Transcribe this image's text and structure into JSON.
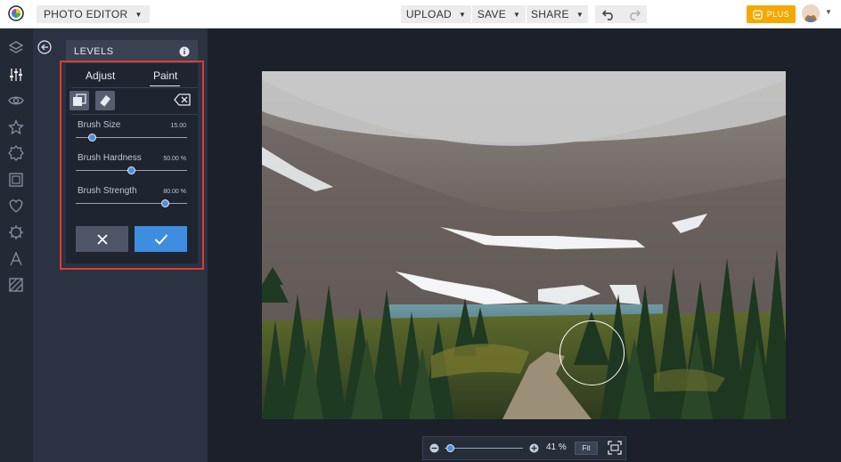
{
  "topbar": {
    "app_label": "PHOTO EDITOR",
    "menus": [
      {
        "label": "UPLOAD"
      },
      {
        "label": "SAVE"
      },
      {
        "label": "SHARE"
      }
    ],
    "plus_label": "PLUS",
    "accent_color": "#f5a800"
  },
  "left_toolbar": {
    "icons": [
      "layers-icon",
      "adjust-sliders-icon",
      "eye-icon",
      "star-icon",
      "badge-icon",
      "frame-icon",
      "heart-icon",
      "gear-icon",
      "text-icon",
      "texture-icon"
    ]
  },
  "panel": {
    "title": "LEVELS",
    "tabs": [
      {
        "label": "Adjust"
      },
      {
        "label": "Paint",
        "active": true
      }
    ],
    "sliders": [
      {
        "label": "Brush Size",
        "value": "15.00",
        "fraction": 0.15
      },
      {
        "label": "Brush Hardness",
        "value": "50.00 %",
        "fraction": 0.5
      },
      {
        "label": "Brush Strength",
        "value": "80.00 %",
        "fraction": 0.8
      }
    ],
    "confirm_color": "#3d8ee0",
    "highlight_color": "#e23a35"
  },
  "zoom": {
    "value": "41 %",
    "fit_label": "Fit",
    "fraction": 0.07
  }
}
